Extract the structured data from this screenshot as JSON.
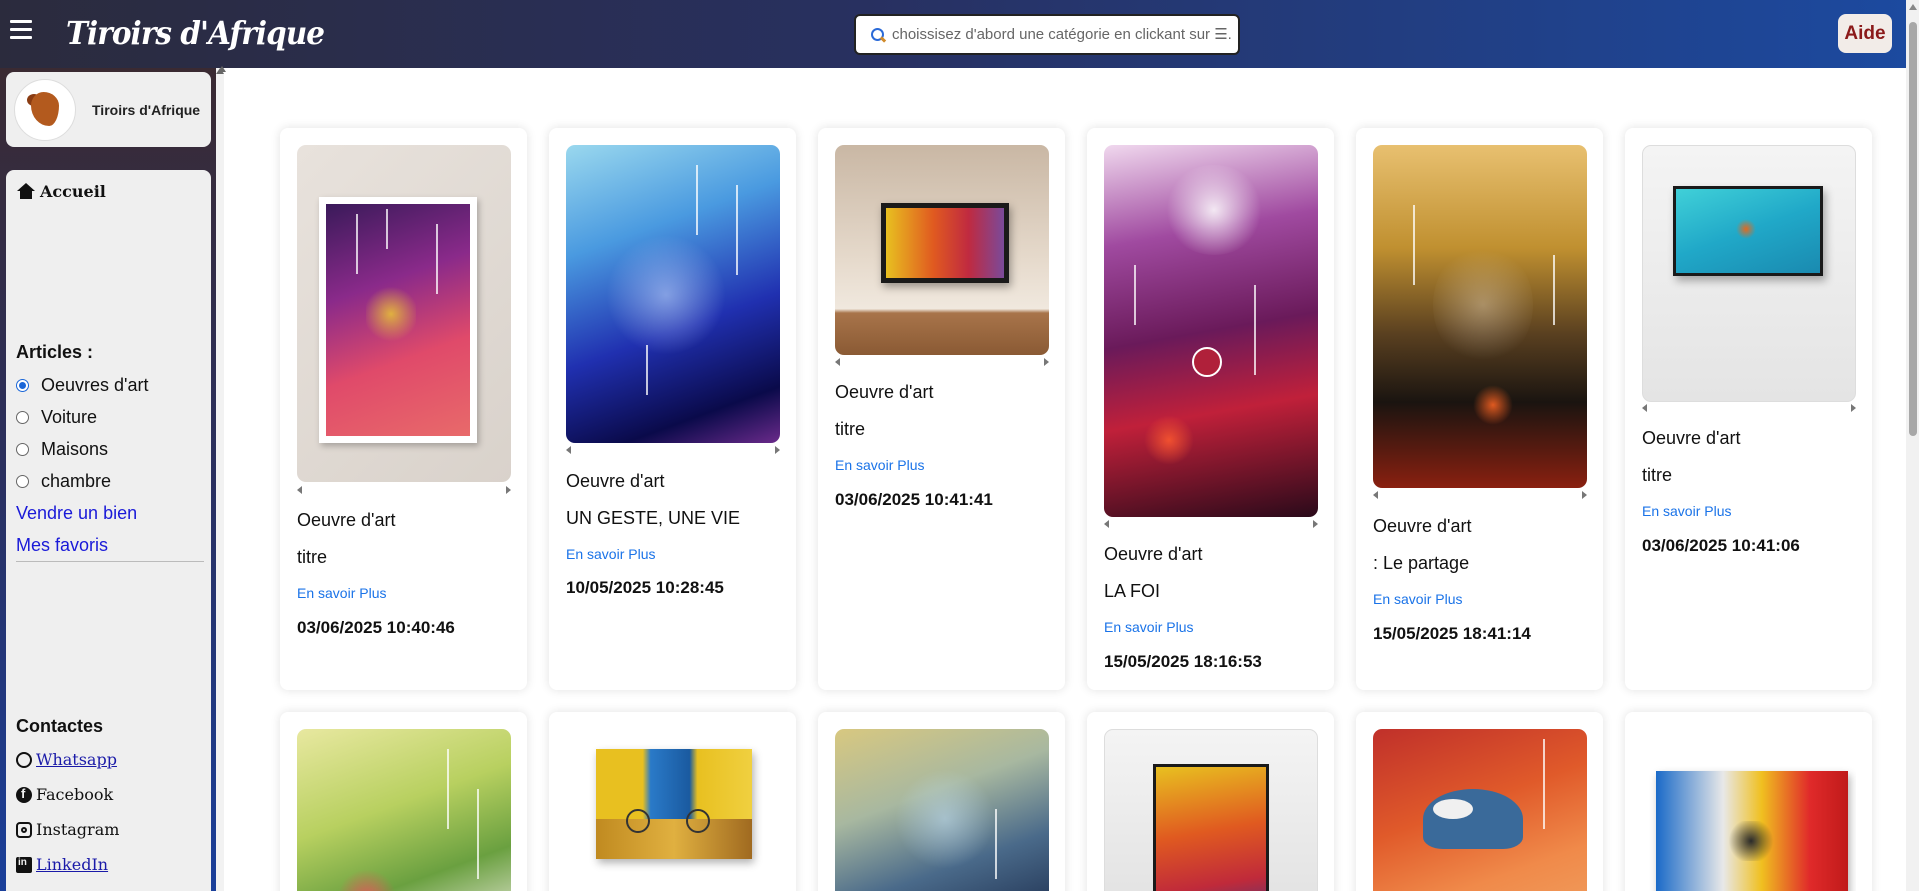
{
  "header": {
    "brand": "Tiroirs d'Afrique",
    "search_placeholder": "choissisez d'abord une catégorie en clickant sur ☰.",
    "help_label": "Aide"
  },
  "sidebar": {
    "profile_name": "Tiroirs d'Afrique",
    "home_label": "Accueil",
    "articles_title": "Articles :",
    "categories": [
      {
        "label": "Oeuvres d'art",
        "checked": true
      },
      {
        "label": "Voiture",
        "checked": false
      },
      {
        "label": "Maisons",
        "checked": false
      },
      {
        "label": "chambre",
        "checked": false
      }
    ],
    "sell_label": "Vendre un bien",
    "favorites_label": "Mes favoris",
    "contacts_title": "Contactes",
    "contacts": [
      {
        "label": "Whatsapp",
        "icon": "whatsapp-icon"
      },
      {
        "label": "Facebook",
        "icon": "facebook-icon"
      },
      {
        "label": "Instagram",
        "icon": "instagram-icon"
      },
      {
        "label": "LinkedIn",
        "icon": "linkedin-icon"
      }
    ]
  },
  "cards": [
    {
      "category": "Oeuvre d'art",
      "title": "titre",
      "more": "En savoir Plus",
      "date": "03/06/2025 10:40:46"
    },
    {
      "category": "Oeuvre d'art",
      "title": "UN GESTE, UNE VIE",
      "more": "En savoir Plus",
      "date": "10/05/2025 10:28:45"
    },
    {
      "category": "Oeuvre d'art",
      "title": "titre",
      "more": "En savoir Plus",
      "date": "03/06/2025 10:41:41"
    },
    {
      "category": "Oeuvre d'art",
      "title": "LA FOI",
      "more": "En savoir Plus",
      "date": "15/05/2025 18:16:53"
    },
    {
      "category": "Oeuvre d'art",
      "title": ": Le partage",
      "more": "En savoir Plus",
      "date": "15/05/2025 18:41:14"
    },
    {
      "category": "Oeuvre d'art",
      "title": "titre",
      "more": "En savoir Plus",
      "date": "03/06/2025 10:41:06"
    }
  ],
  "colors": {
    "accent_link": "#1a73e8",
    "nav_link": "#1a1ad8",
    "help_text": "#8b1a1a"
  }
}
